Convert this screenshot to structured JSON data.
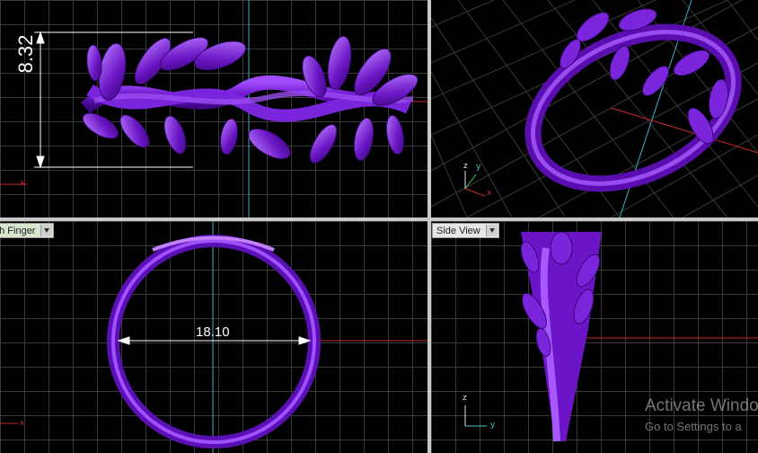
{
  "viewports": {
    "top_left": {
      "dimension": "8.32"
    },
    "top_right": {},
    "bottom_left": {
      "label": "gh Finger",
      "dimension": "18.10"
    },
    "bottom_right": {
      "label": "Side View"
    }
  },
  "axes": {
    "x": "x",
    "y": "y",
    "z": "z"
  },
  "colors": {
    "model": "#7a1fd6",
    "grid": "#3a3a3a",
    "axis_x": "#c82828",
    "axis_y": "#3ab0c8",
    "dimension_line": "#ffffff"
  },
  "watermark": {
    "title": "Activate Windo",
    "subtitle": "Go to Settings to a"
  }
}
